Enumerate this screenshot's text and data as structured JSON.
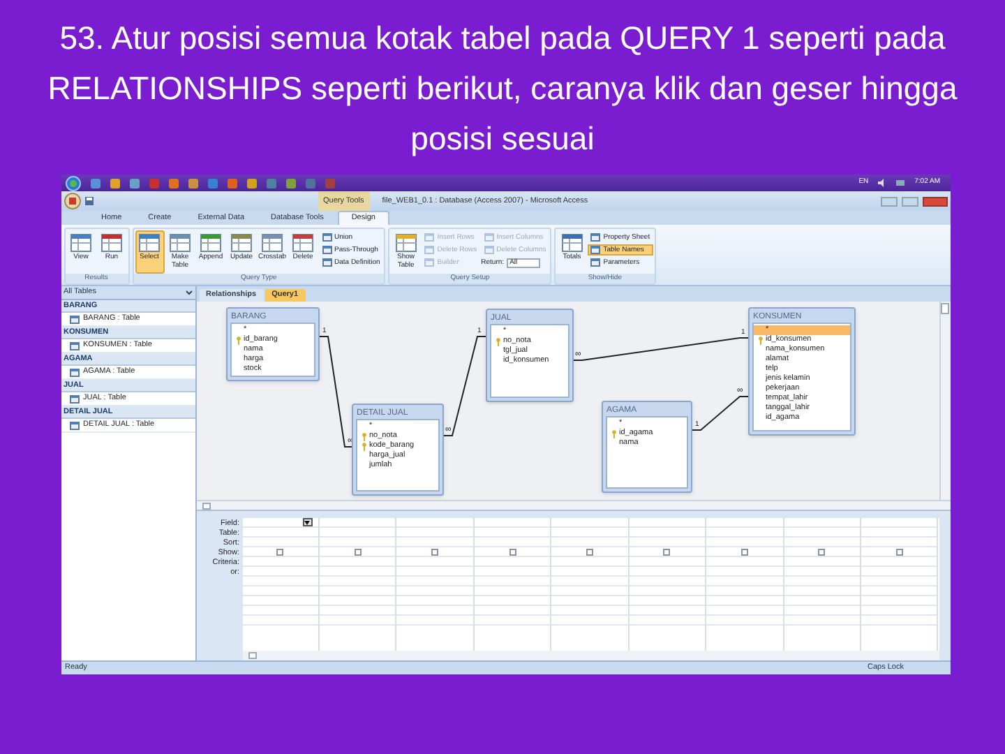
{
  "slide_title": "53. Atur posisi semua kotak tabel pada QUERY 1 seperti pada RELATIONSHIPS seperti berikut, caranya klik dan geser hingga posisi sesuai",
  "taskbar": {
    "language": "EN",
    "clock": "7:02 AM"
  },
  "window": {
    "contextual_tab": "Query Tools",
    "title": "file_WEB1_0.1 : Database (Access 2007) - Microsoft Access"
  },
  "ribbon_tabs": [
    {
      "label": "Home",
      "selected": false
    },
    {
      "label": "Create",
      "selected": false
    },
    {
      "label": "External Data",
      "selected": false
    },
    {
      "label": "Database Tools",
      "selected": false
    },
    {
      "label": "Design",
      "selected": true
    }
  ],
  "ribbon_groups": [
    {
      "label": "Results",
      "buttons": [
        {
          "kind": "large",
          "label": "View",
          "selected": false,
          "disabled": false
        },
        {
          "kind": "large",
          "label": "Run",
          "selected": false,
          "disabled": false
        }
      ]
    },
    {
      "label": "Query Type",
      "buttons": [
        {
          "kind": "large",
          "label": "Select",
          "selected": true,
          "disabled": false
        },
        {
          "kind": "large",
          "label": "Make Table",
          "selected": false,
          "disabled": false
        },
        {
          "kind": "large",
          "label": "Append",
          "selected": false,
          "disabled": false
        },
        {
          "kind": "large",
          "label": "Update",
          "selected": false,
          "disabled": false
        },
        {
          "kind": "large",
          "label": "Crosstab",
          "selected": false,
          "disabled": false
        },
        {
          "kind": "large",
          "label": "Delete",
          "selected": false,
          "disabled": false
        },
        {
          "kind": "small",
          "label": "Union",
          "selected": false,
          "disabled": false
        },
        {
          "kind": "small",
          "label": "Pass-Through",
          "selected": false,
          "disabled": false
        },
        {
          "kind": "small",
          "label": "Data Definition",
          "selected": false,
          "disabled": false
        }
      ]
    },
    {
      "label": "Query Setup",
      "buttons": [
        {
          "kind": "large",
          "label": "Show Table",
          "selected": false,
          "disabled": false
        },
        {
          "kind": "small",
          "label": "Insert Rows",
          "selected": false,
          "disabled": true
        },
        {
          "kind": "small",
          "label": "Delete Rows",
          "selected": false,
          "disabled": true
        },
        {
          "kind": "small",
          "label": "Builder",
          "selected": false,
          "disabled": true
        },
        {
          "kind": "small",
          "label": "Insert Columns",
          "selected": false,
          "disabled": true
        },
        {
          "kind": "small",
          "label": "Delete Columns",
          "selected": false,
          "disabled": true
        },
        {
          "kind": "dropdown",
          "label": "Return:",
          "value": "All",
          "selected": false,
          "disabled": false
        }
      ]
    },
    {
      "label": "Show/Hide",
      "buttons": [
        {
          "kind": "large",
          "label": "Totals",
          "selected": false,
          "disabled": false
        },
        {
          "kind": "small",
          "label": "Property Sheet",
          "selected": false,
          "disabled": false
        },
        {
          "kind": "small",
          "label": "Table Names",
          "selected": true,
          "disabled": false
        },
        {
          "kind": "small",
          "label": "Parameters",
          "selected": false,
          "disabled": false
        }
      ]
    }
  ],
  "nav_pane": {
    "header": "All Tables",
    "groups": [
      {
        "label": "BARANG",
        "items": [
          "BARANG : Table"
        ]
      },
      {
        "label": "KONSUMEN",
        "items": [
          "KONSUMEN : Table"
        ]
      },
      {
        "label": "AGAMA",
        "items": [
          "AGAMA : Table"
        ]
      },
      {
        "label": "JUAL",
        "items": [
          "JUAL : Table"
        ]
      },
      {
        "label": "DETAIL JUAL",
        "items": [
          "DETAIL JUAL : Table"
        ]
      }
    ]
  },
  "document_tabs": [
    {
      "label": "Relationships",
      "selected": false
    },
    {
      "label": "Query1",
      "selected": true
    }
  ],
  "tables": [
    {
      "name": "BARANG",
      "fields": [
        {
          "name": "*",
          "key": false,
          "selected": false
        },
        {
          "name": "id_barang",
          "key": true,
          "selected": false
        },
        {
          "name": "nama",
          "key": false,
          "selected": false
        },
        {
          "name": "harga",
          "key": false,
          "selected": false
        },
        {
          "name": "stock",
          "key": false,
          "selected": false
        }
      ]
    },
    {
      "name": "JUAL",
      "fields": [
        {
          "name": "*",
          "key": false,
          "selected": false
        },
        {
          "name": "no_nota",
          "key": true,
          "selected": false
        },
        {
          "name": "tgl_jual",
          "key": false,
          "selected": false
        },
        {
          "name": "id_konsumen",
          "key": false,
          "selected": false
        }
      ]
    },
    {
      "name": "DETAIL JUAL",
      "fields": [
        {
          "name": "*",
          "key": false,
          "selected": false
        },
        {
          "name": "no_nota",
          "key": true,
          "selected": false
        },
        {
          "name": "kode_barang",
          "key": true,
          "selected": false
        },
        {
          "name": "harga_jual",
          "key": false,
          "selected": false
        },
        {
          "name": "jumlah",
          "key": false,
          "selected": false
        }
      ]
    },
    {
      "name": "KONSUMEN",
      "fields": [
        {
          "name": "*",
          "key": false,
          "selected": true
        },
        {
          "name": "id_konsumen",
          "key": true,
          "selected": false
        },
        {
          "name": "nama_konsumen",
          "key": false,
          "selected": false
        },
        {
          "name": "alamat",
          "key": false,
          "selected": false
        },
        {
          "name": "telp",
          "key": false,
          "selected": false
        },
        {
          "name": "jenis kelamin",
          "key": false,
          "selected": false
        },
        {
          "name": "pekerjaan",
          "key": false,
          "selected": false
        },
        {
          "name": "tempat_lahir",
          "key": false,
          "selected": false
        },
        {
          "name": "tanggal_lahir",
          "key": false,
          "selected": false
        },
        {
          "name": "id_agama",
          "key": false,
          "selected": false
        }
      ]
    },
    {
      "name": "AGAMA",
      "fields": [
        {
          "name": "*",
          "key": false,
          "selected": false
        },
        {
          "name": "id_agama",
          "key": true,
          "selected": false
        },
        {
          "name": "nama",
          "key": false,
          "selected": false
        }
      ]
    }
  ],
  "relationships": [
    {
      "one_label": "1",
      "many_label": "∞"
    },
    {
      "one_label": "1",
      "many_label": "∞"
    },
    {
      "one_label": "1",
      "many_label": "∞"
    },
    {
      "one_label": "1",
      "many_label": "∞"
    }
  ],
  "design_grid": {
    "row_labels": [
      "Field:",
      "Table:",
      "Sort:",
      "Show:",
      "Criteria:",
      "or:"
    ],
    "columns": [
      {
        "checked": false
      },
      {
        "checked": false
      },
      {
        "checked": false
      },
      {
        "checked": false
      },
      {
        "checked": false
      },
      {
        "checked": false
      },
      {
        "checked": false
      },
      {
        "checked": false
      },
      {
        "checked": false
      }
    ]
  },
  "status_bar": {
    "left": "Ready",
    "right": "Caps Lock"
  }
}
